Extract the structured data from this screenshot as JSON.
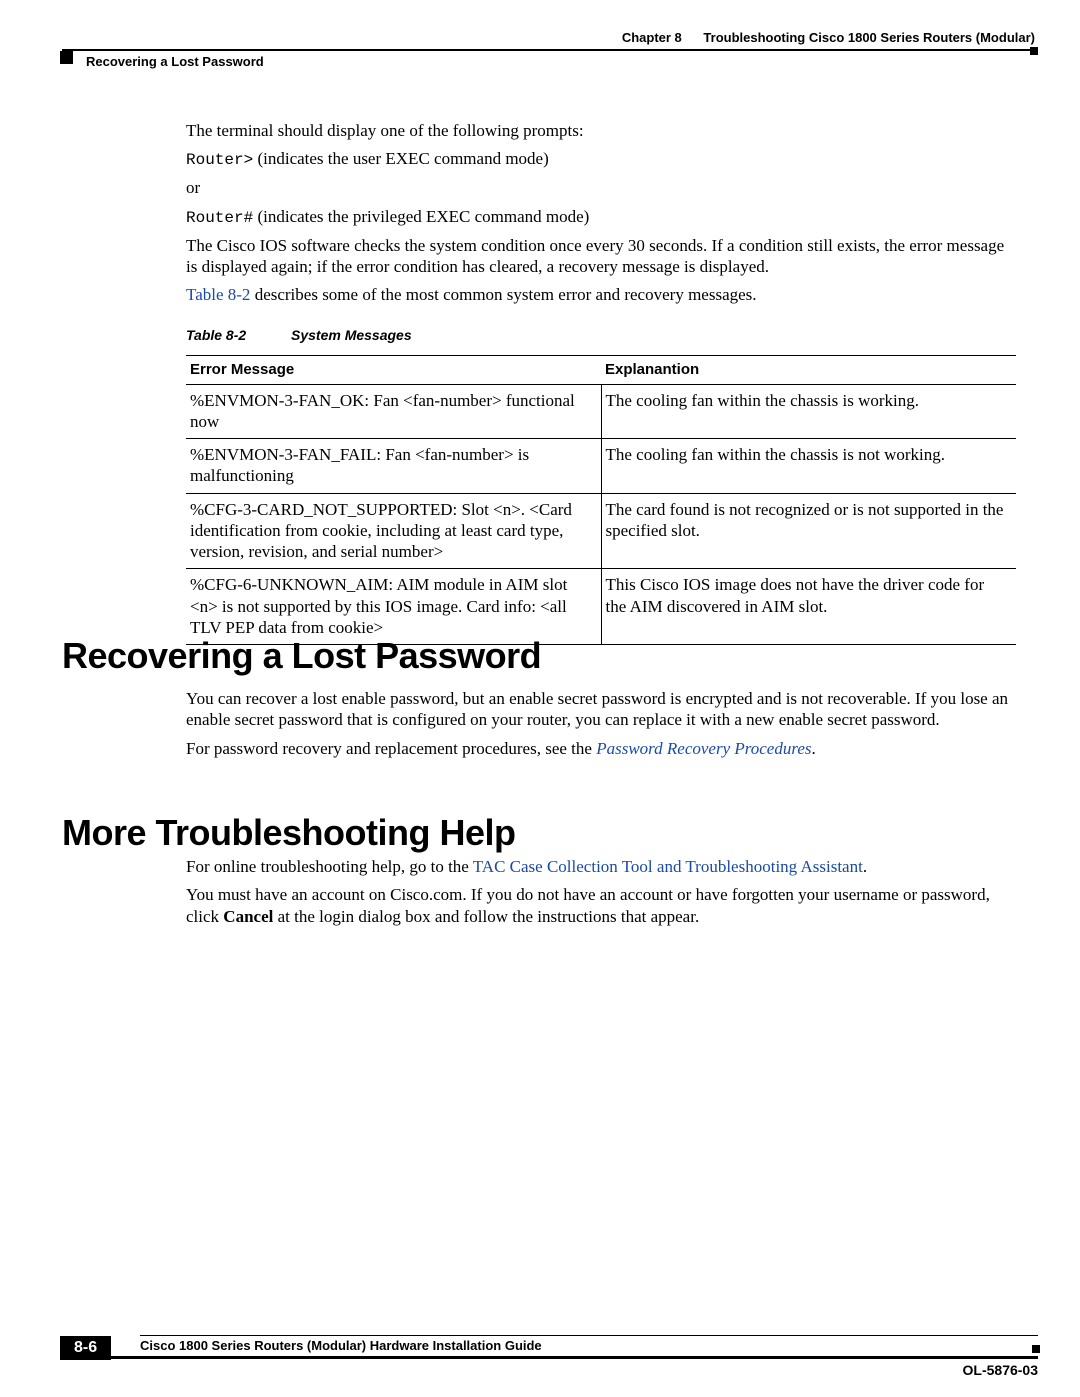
{
  "header": {
    "chapter_label": "Chapter 8",
    "chapter_title": "Troubleshooting Cisco 1800 Series Routers (Modular)",
    "section_breadcrumb": "Recovering a Lost Password"
  },
  "body": {
    "p1": "The terminal should display one of the following prompts:",
    "code1": "Router>",
    "p2_tail": " (indicates the user EXEC command mode)",
    "p3": "or",
    "code2": "Router#",
    "p4_tail": " (indicates the privileged EXEC command mode)",
    "p5": "The Cisco IOS software checks the system condition once every 30 seconds. If a condition still exists, the error message is displayed again; if the error condition has cleared, a recovery message is displayed.",
    "p6_link": "Table 8-2",
    "p6_tail": " describes some of the most common system error and recovery messages."
  },
  "table": {
    "label_num": "Table 8-2",
    "label_title": "System Messages",
    "col1": "Error Message",
    "col2": "Explanantion",
    "rows": [
      {
        "msg": "%ENVMON-3-FAN_OK: Fan <fan-number> functional now",
        "expl": "The cooling fan within the chassis is working."
      },
      {
        "msg": "%ENVMON-3-FAN_FAIL: Fan <fan-number> is malfunctioning",
        "expl": "The cooling fan within the chassis is not working."
      },
      {
        "msg": "%CFG-3-CARD_NOT_SUPPORTED: Slot <n>. <Card identification from cookie, including at least card type, version, revision, and serial number>",
        "expl": "The card found is not recognized or is not supported in the specified slot."
      },
      {
        "msg": "%CFG-6-UNKNOWN_AIM: AIM module in AIM slot <n> is not supported by this IOS image. Card info: <all TLV PEP data from cookie>",
        "expl": "This Cisco IOS image does not have the driver code for the AIM discovered in AIM slot."
      }
    ]
  },
  "recover": {
    "heading": "Recovering a Lost Password",
    "p1": "You can recover a lost enable password, but an enable secret password is encrypted and is not recoverable. If you lose an enable secret password that is configured on your router, you can replace it with a new enable secret password.",
    "p2_lead": "For password recovery and replacement procedures, see the ",
    "p2_link": "Password Recovery Procedures",
    "p2_end": "."
  },
  "more": {
    "heading": "More Troubleshooting Help",
    "p1_lead": "For online troubleshooting help, go to the ",
    "p1_link": "TAC Case Collection Tool and Troubleshooting Assistant",
    "p1_end": ".",
    "p2_a": "You must have an account on Cisco.com. If you do not have an account or have forgotten your username or password, click ",
    "p2_bold": "Cancel",
    "p2_b": " at the login dialog box and follow the instructions that appear."
  },
  "footer": {
    "guide_title": "Cisco 1800 Series Routers (Modular) Hardware Installation Guide",
    "page_num": "8-6",
    "doc_id": "OL-5876-03"
  }
}
